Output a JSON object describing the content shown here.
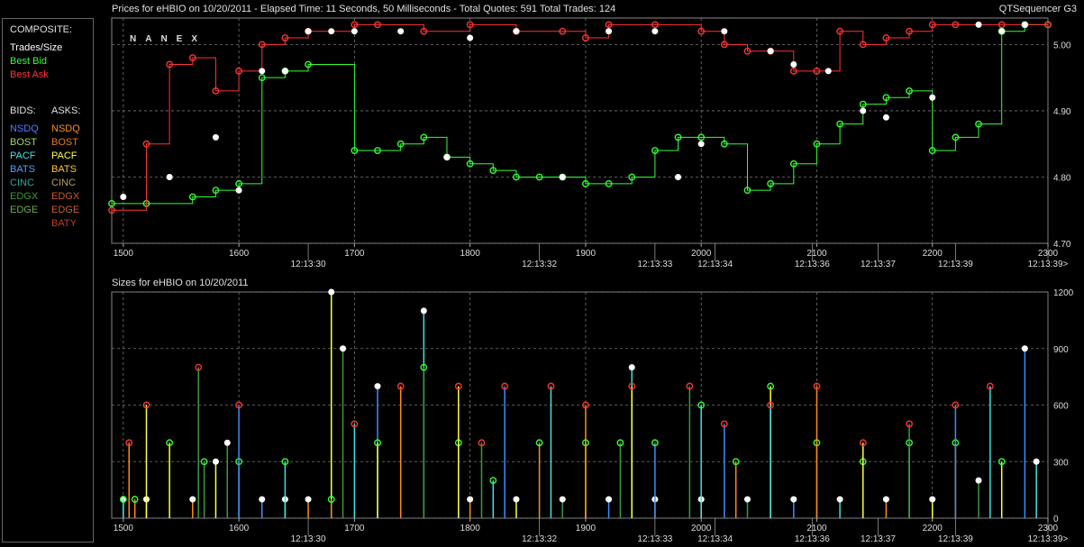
{
  "header": {
    "price_title": "Prices for  eHBIO  on  10/20/2011  -  Elapsed Time: 11 Seconds, 50 Milliseconds  -  Total Quotes: 591  Total Trades: 124",
    "app_name": "QTSequencer G3",
    "size_title": "Sizes for  eHBIO  on  10/20/2011",
    "watermark": "NANEX"
  },
  "legend": {
    "composite_label": "COMPOSITE:",
    "trades_size": "Trades/Size",
    "best_bid": "Best Bid",
    "best_ask": "Best Ask",
    "bids_label": "BIDS:",
    "asks_label": "ASKS:",
    "bids": [
      {
        "name": "NSDQ",
        "color": "#4f7fff"
      },
      {
        "name": "BOST",
        "color": "#a8d860"
      },
      {
        "name": "PACF",
        "color": "#40e0e0"
      },
      {
        "name": "BATS",
        "color": "#5aa0ff"
      },
      {
        "name": "CINC",
        "color": "#3aa0a0"
      },
      {
        "name": "EDGX",
        "color": "#3a9a3a"
      },
      {
        "name": "EDGE",
        "color": "#6ab04a"
      }
    ],
    "asks": [
      {
        "name": "NSDQ",
        "color": "#ff8c1a"
      },
      {
        "name": "BOST",
        "color": "#e07a2a"
      },
      {
        "name": "PACF",
        "color": "#ffff40"
      },
      {
        "name": "BATS",
        "color": "#ffc830"
      },
      {
        "name": "CINC",
        "color": "#b8a060"
      },
      {
        "name": "EDGX",
        "color": "#d05a20"
      },
      {
        "name": "EDGE",
        "color": "#c86030"
      },
      {
        "name": "BATY",
        "color": "#c04020"
      }
    ],
    "colors": {
      "trades": "#ffffff",
      "best_bid": "#33ff33",
      "best_ask": "#ff3333",
      "composite": "#ffffff"
    }
  },
  "chart_data": [
    {
      "type": "line",
      "title": "Prices for  eHBIO  on  10/20/2011",
      "xlim": [
        1490,
        2300
      ],
      "ylim": [
        4.7,
        5.04
      ],
      "x_ticks": [
        "1500",
        "1600",
        "1700",
        "1800",
        "1900",
        "2000",
        "2100",
        "2200",
        "2300"
      ],
      "y_ticks": [
        "4.70",
        "4.80",
        "4.90",
        "5.00"
      ],
      "time_labels": [
        {
          "x": 1660,
          "label": "12:13:30"
        },
        {
          "x": 1860,
          "label": "12:13:32"
        },
        {
          "x": 1960,
          "label": "12:13:33"
        },
        {
          "x": 2012,
          "label": "12:13:34"
        },
        {
          "x": 2096,
          "label": "12:13:36"
        },
        {
          "x": 2153,
          "label": "12:13:37"
        },
        {
          "x": 2220,
          "label": "12:13:39"
        },
        {
          "x": 2300,
          "label": "12:13:39>"
        }
      ],
      "grid": true,
      "series": [
        {
          "name": "Best Bid",
          "x": [
            1490,
            1520,
            1560,
            1580,
            1600,
            1620,
            1640,
            1660,
            1700,
            1720,
            1740,
            1760,
            1780,
            1800,
            1820,
            1840,
            1860,
            1880,
            1900,
            1920,
            1940,
            1960,
            1980,
            2000,
            2020,
            2040,
            2060,
            2080,
            2100,
            2120,
            2140,
            2160,
            2180,
            2200,
            2220,
            2240,
            2260,
            2280,
            2300
          ],
          "values": [
            4.76,
            4.76,
            4.77,
            4.78,
            4.79,
            4.95,
            4.96,
            4.97,
            4.84,
            4.84,
            4.85,
            4.86,
            4.83,
            4.82,
            4.81,
            4.8,
            4.8,
            4.8,
            4.79,
            4.79,
            4.8,
            4.84,
            4.86,
            4.86,
            4.85,
            4.78,
            4.79,
            4.82,
            4.85,
            4.88,
            4.91,
            4.92,
            4.93,
            4.84,
            4.86,
            4.88,
            5.02,
            5.03,
            5.03
          ]
        },
        {
          "name": "Best Ask",
          "x": [
            1490,
            1520,
            1540,
            1560,
            1580,
            1600,
            1620,
            1640,
            1660,
            1700,
            1720,
            1760,
            1800,
            1840,
            1880,
            1900,
            1920,
            1960,
            2000,
            2020,
            2040,
            2060,
            2080,
            2100,
            2120,
            2140,
            2160,
            2180,
            2200,
            2220,
            2260,
            2300
          ],
          "values": [
            4.75,
            4.85,
            4.97,
            4.98,
            4.93,
            4.96,
            5.0,
            5.01,
            5.02,
            5.03,
            5.03,
            5.02,
            5.03,
            5.02,
            5.02,
            5.01,
            5.03,
            5.03,
            5.02,
            5.0,
            4.99,
            4.99,
            4.96,
            4.96,
            5.02,
            5.0,
            5.01,
            5.02,
            5.03,
            5.03,
            5.03,
            5.03
          ]
        },
        {
          "name": "Trades/Size",
          "x": [
            1500,
            1540,
            1580,
            1600,
            1620,
            1640,
            1660,
            1680,
            1700,
            1740,
            1780,
            1800,
            1840,
            1880,
            1920,
            1960,
            1980,
            2000,
            2020,
            2060,
            2080,
            2110,
            2140,
            2160,
            2200,
            2240,
            2260,
            2280
          ],
          "values": [
            4.77,
            4.8,
            4.86,
            4.78,
            4.96,
            4.96,
            5.02,
            5.02,
            5.02,
            5.02,
            4.83,
            5.01,
            5.02,
            4.8,
            5.02,
            5.02,
            4.8,
            4.85,
            5.02,
            4.99,
            4.97,
            4.96,
            4.9,
            4.89,
            4.92,
            5.03,
            5.02,
            5.03
          ]
        }
      ]
    },
    {
      "type": "bar",
      "title": "Sizes for  eHBIO  on  10/20/2011",
      "xlim": [
        1490,
        2300
      ],
      "ylim": [
        0,
        1200
      ],
      "x_ticks": [
        "1500",
        "1600",
        "1700",
        "1800",
        "1900",
        "2000",
        "2100",
        "2200",
        "2300"
      ],
      "y_ticks": [
        "0",
        "300",
        "600",
        "900",
        "1200"
      ],
      "time_labels": [
        {
          "x": 1660,
          "label": "12:13:30"
        },
        {
          "x": 1860,
          "label": "12:13:32"
        },
        {
          "x": 1960,
          "label": "12:13:33"
        },
        {
          "x": 2012,
          "label": "12:13:34"
        },
        {
          "x": 2096,
          "label": "12:13:36"
        },
        {
          "x": 2153,
          "label": "12:13:37"
        },
        {
          "x": 2220,
          "label": "12:13:39"
        },
        {
          "x": 2300,
          "label": "12:13:39>"
        }
      ],
      "grid": true,
      "series": [
        {
          "name": "Trades/Size",
          "x": [
            1500,
            1520,
            1560,
            1580,
            1590,
            1620,
            1640,
            1660,
            1680,
            1690,
            1720,
            1760,
            1800,
            1840,
            1880,
            1920,
            1940,
            1960,
            2000,
            2040,
            2080,
            2120,
            2160,
            2200,
            2240,
            2280,
            2290
          ],
          "values": [
            100,
            100,
            100,
            300,
            400,
            100,
            100,
            100,
            1200,
            900,
            700,
            1100,
            100,
            100,
            100,
            100,
            800,
            100,
            100,
            100,
            100,
            100,
            100,
            100,
            200,
            900,
            300
          ]
        },
        {
          "name": "Best Bid",
          "x": [
            1500,
            1510,
            1540,
            1570,
            1600,
            1640,
            1680,
            1720,
            1760,
            1790,
            1820,
            1860,
            1900,
            1930,
            1960,
            2000,
            2030,
            2060,
            2100,
            2140,
            2180,
            2220,
            2260
          ],
          "values": [
            100,
            100,
            400,
            300,
            300,
            300,
            100,
            400,
            800,
            400,
            200,
            400,
            400,
            400,
            400,
            600,
            300,
            700,
            400,
            300,
            400,
            400,
            300
          ]
        },
        {
          "name": "Best Ask",
          "x": [
            1505,
            1520,
            1565,
            1600,
            1700,
            1740,
            1790,
            1810,
            1830,
            1870,
            1900,
            1940,
            1990,
            2020,
            2060,
            2100,
            2140,
            2180,
            2220,
            2250
          ],
          "values": [
            400,
            600,
            800,
            600,
            500,
            700,
            700,
            400,
            700,
            700,
            600,
            700,
            700,
            500,
            600,
            700,
            400,
            500,
            600,
            700
          ]
        }
      ]
    }
  ]
}
